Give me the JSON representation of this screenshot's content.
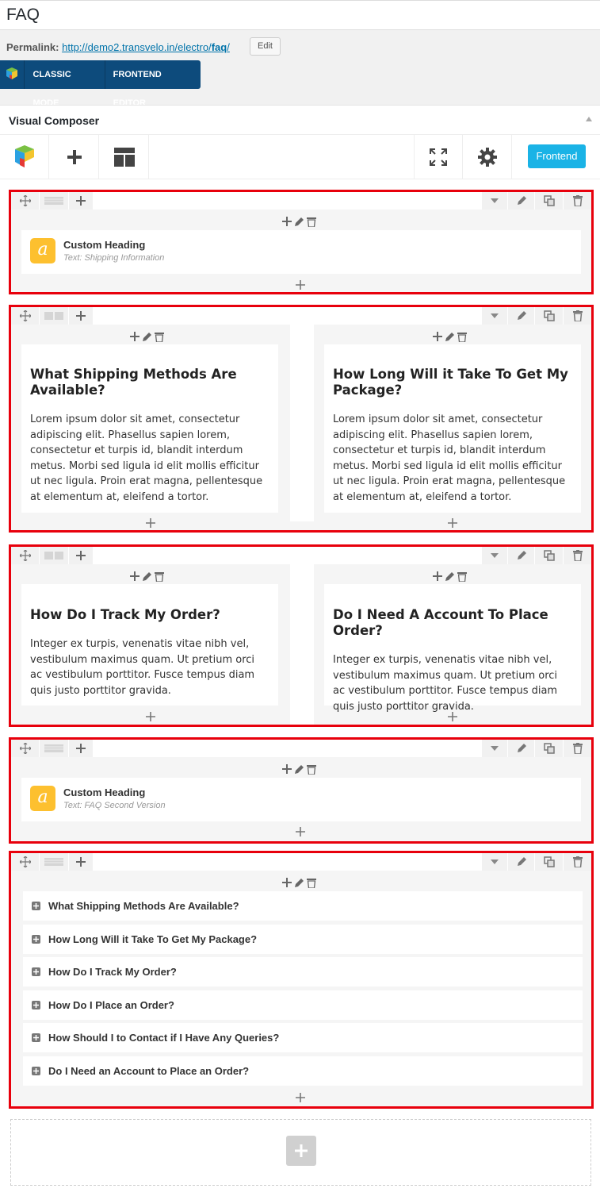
{
  "page_title": "FAQ",
  "permalink": {
    "label": "Permalink:",
    "url_prefix": "http://demo2.transvelo.in/electro/",
    "slug": "faq",
    "url_suffix": "/",
    "edit_label": "Edit"
  },
  "mode_bar": {
    "classic_label": "CLASSIC MODE",
    "frontend_label": "FRONTEND EDITOR"
  },
  "composer": {
    "title": "Visual Composer",
    "frontend_button": "Frontend"
  },
  "row1": {
    "element_name": "Custom Heading",
    "element_text": "Text: Shipping Information"
  },
  "row2": {
    "left": {
      "heading": "What Shipping Methods Are Available?",
      "body": "Lorem ipsum dolor sit amet, consectetur adipiscing elit. Phasellus sapien lorem, consectetur et turpis id, blandit interdum metus. Morbi sed ligula id elit mollis efficitur ut nec ligula. Proin erat magna, pellentesque at elementum at, eleifend a tortor."
    },
    "right": {
      "heading": "How Long Will it Take To Get My Package?",
      "body": "Lorem ipsum dolor sit amet, consectetur adipiscing elit. Phasellus sapien lorem, consectetur et turpis id, blandit interdum metus. Morbi sed ligula id elit mollis efficitur ut nec ligula. Proin erat magna, pellentesque at elementum at, eleifend a tortor."
    }
  },
  "row3": {
    "left": {
      "heading": "How Do I Track My Order?",
      "body": "Integer ex turpis, venenatis vitae nibh vel, vestibulum maximus quam. Ut pretium orci ac vestibulum porttitor. Fusce tempus diam quis justo porttitor gravida."
    },
    "right": {
      "heading": "Do I Need A Account To Place Order?",
      "body": "Integer ex turpis, venenatis vitae nibh vel, vestibulum maximus quam. Ut pretium orci ac vestibulum porttitor. Fusce tempus diam quis justo porttitor gravida."
    }
  },
  "row4": {
    "element_name": "Custom Heading",
    "element_text": "Text: FAQ Second Version"
  },
  "row5": {
    "items": [
      "What Shipping Methods Are Available?",
      "How Long Will it Take To Get My Package?",
      "How Do I Track My Order?",
      "How Do I Place an Order?",
      "How Should I to Contact if I Have Any Queries?",
      "Do I Need an Account to Place an Order?"
    ]
  },
  "colors": {
    "row_highlight": "#e8000c",
    "mode_bar": "#0d4b7c",
    "frontend_button": "#1ab3e6",
    "custom_heading_icon": "#fdc02f"
  }
}
